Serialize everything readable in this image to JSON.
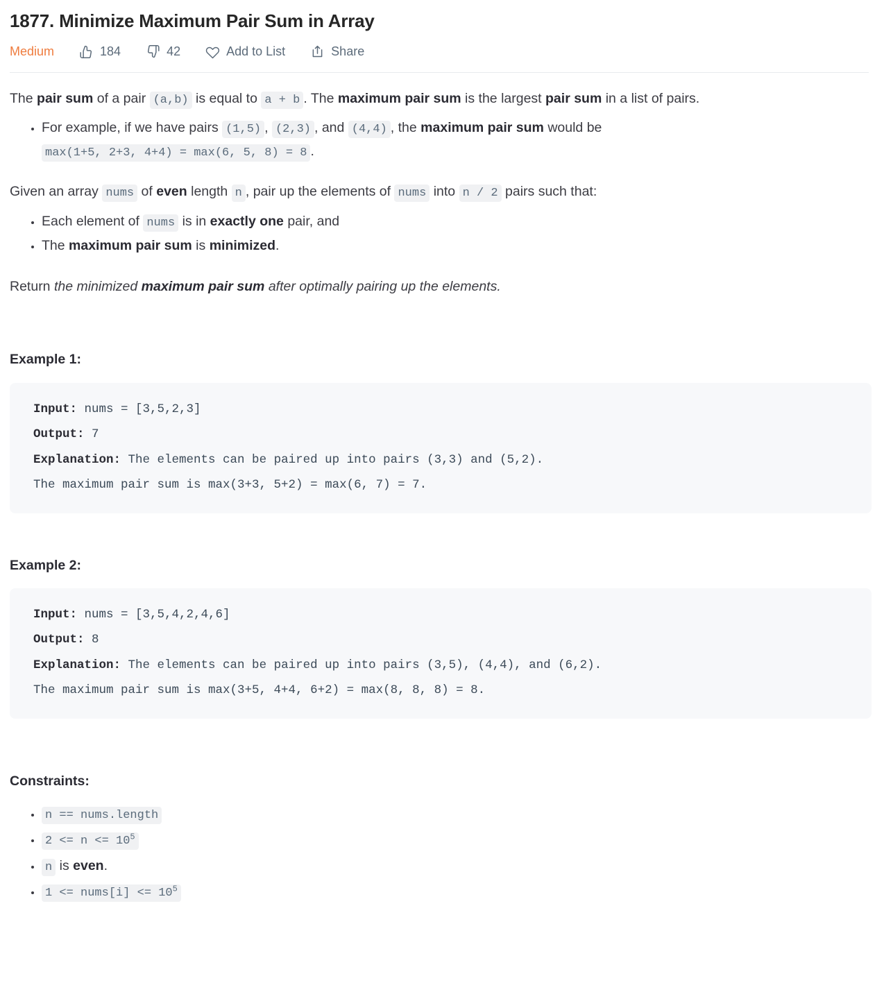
{
  "header": {
    "title": "1877. Minimize Maximum Pair Sum in Array",
    "difficulty": "Medium",
    "difficulty_color": "#ef7c3e",
    "likes": "184",
    "dislikes": "42",
    "add_to_list_label": "Add to List",
    "share_label": "Share"
  },
  "description": {
    "p1": {
      "t1": "The ",
      "b1": "pair sum",
      "t2": " of a pair ",
      "c1": "(a,b)",
      "t3": " is equal to ",
      "c2": "a + b",
      "t4": ". The ",
      "b2": "maximum pair sum",
      "t5": " is the largest ",
      "b3": "pair sum",
      "t6": " in a list of pairs."
    },
    "bullet1": {
      "t1": "For example, if we have pairs ",
      "c1": "(1,5)",
      "t2": ", ",
      "c2": "(2,3)",
      "t3": ", and ",
      "c3": "(4,4)",
      "t4": ", the ",
      "b1": "maximum pair sum",
      "t5": " would be ",
      "c4": "max(1+5, 2+3, 4+4) = max(6, 5, 8) = 8",
      "t6": "."
    },
    "p2": {
      "t1": "Given an array ",
      "c1": "nums",
      "t2": " of ",
      "b1": "even",
      "t3": " length ",
      "c2": "n",
      "t4": ", pair up the elements of ",
      "c3": "nums",
      "t5": " into ",
      "c4": "n / 2",
      "t6": " pairs such that:"
    },
    "bullet2": {
      "t1": "Each element of ",
      "c1": "nums",
      "t2": " is in ",
      "b1": "exactly one",
      "t3": " pair, and"
    },
    "bullet3": {
      "t1": "The ",
      "b1": "maximum pair sum",
      "t2": " is ",
      "b2": "minimized",
      "t3": "."
    },
    "p3": {
      "t1": "Return ",
      "i1": "the minimized ",
      "bi1": "maximum pair sum",
      "i2": " after optimally pairing up the elements."
    }
  },
  "examples": [
    {
      "heading": "Example 1:",
      "input_label": "Input:",
      "input_value": " nums = [3,5,2,3]",
      "output_label": "Output:",
      "output_value": " 7",
      "explanation_label": "Explanation:",
      "explanation_value": " The elements can be paired up into pairs (3,3) and (5,2).\nThe maximum pair sum is max(3+3, 5+2) = max(6, 7) = 7."
    },
    {
      "heading": "Example 2:",
      "input_label": "Input:",
      "input_value": " nums = [3,5,4,2,4,6]",
      "output_label": "Output:",
      "output_value": " 8",
      "explanation_label": "Explanation:",
      "explanation_value": " The elements can be paired up into pairs (3,5), (4,4), and (6,2).\nThe maximum pair sum is max(3+5, 4+4, 6+2) = max(8, 8, 8) = 8."
    }
  ],
  "constraints": {
    "heading": "Constraints:",
    "items": [
      {
        "code_base": "n == nums.length",
        "sup": "",
        "after": ""
      },
      {
        "code_base": "2 <= n <= 10",
        "sup": "5",
        "after": ""
      },
      {
        "code_base": "n",
        "sup": "",
        "after": " is even."
      },
      {
        "code_base": "1 <= nums[i] <= 10",
        "sup": "5",
        "after": ""
      }
    ],
    "item3_after_plain": " is ",
    "item3_bold": "even",
    "item3_period": "."
  }
}
